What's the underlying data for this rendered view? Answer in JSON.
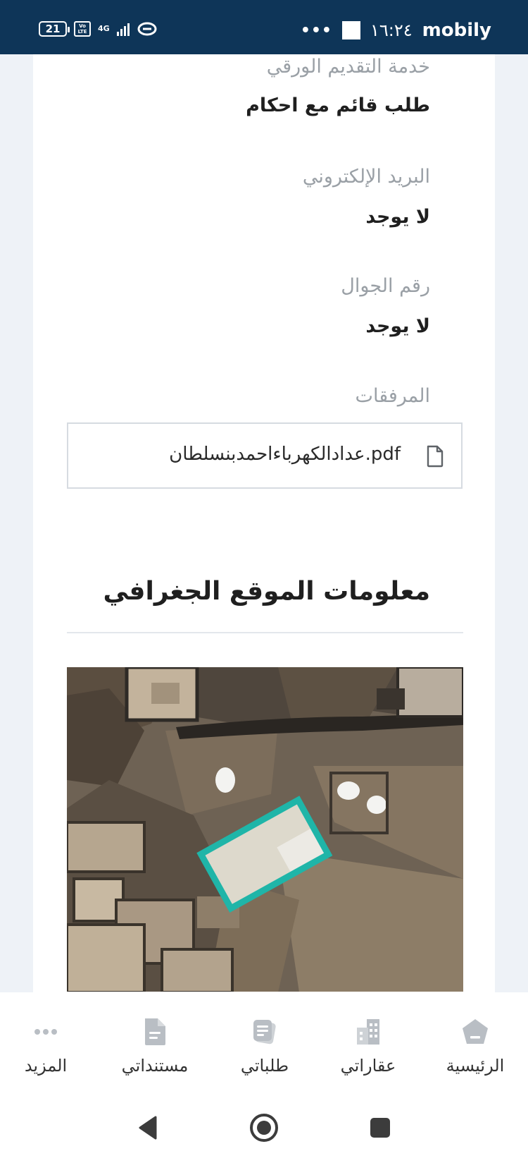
{
  "status_bar": {
    "battery": "21",
    "volte": "Vo LTE",
    "network": "4G",
    "time": "١٦:٢٤",
    "carrier": "mobily",
    "dots": "•••"
  },
  "details": {
    "paper_service_label": "خدمة التقديم الورقي",
    "paper_service_value": "طلب قائم مع احكام",
    "email_label": "البريد الإلكتروني",
    "email_value": "لا يوجد",
    "mobile_label": "رقم الجوال",
    "mobile_value": "لا يوجد",
    "attachments_label": "المرفقات",
    "attachment_file": "عدادالكهرباءاحمدبنسلطان.pdf"
  },
  "geo_section": {
    "title": "معلومات الموقع الجغرافي"
  },
  "bottom_nav": {
    "items": [
      {
        "label": "الرئيسية",
        "icon": "home-icon"
      },
      {
        "label": "عقاراتي",
        "icon": "buildings-icon"
      },
      {
        "label": "طلباتي",
        "icon": "requests-icon"
      },
      {
        "label": "مستنداتي",
        "icon": "document-icon"
      },
      {
        "label": "المزيد",
        "icon": "more-dots-icon"
      }
    ]
  },
  "colors": {
    "status_bar": "#0e3558",
    "parcel_outline": "#1fb5a8",
    "nav_icon": "#b9bec4"
  }
}
